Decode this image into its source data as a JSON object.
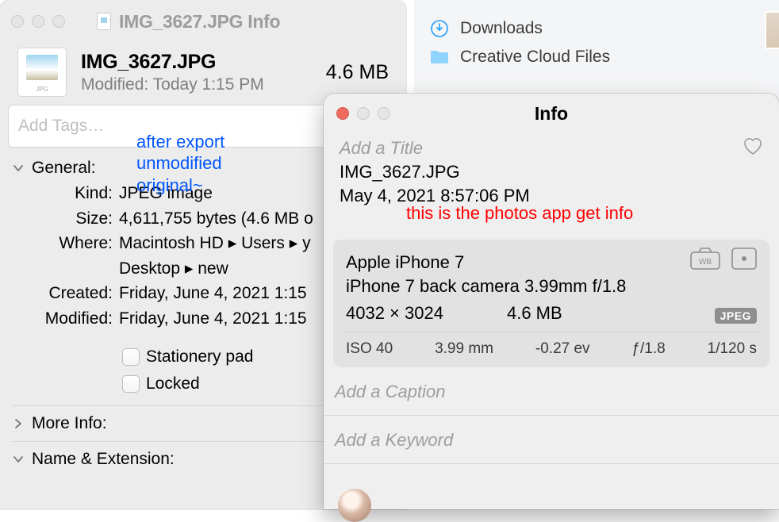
{
  "finder_sidebar": {
    "items": [
      "Downloads",
      "Creative Cloud Files"
    ]
  },
  "getinfo": {
    "window_title": "IMG_3627.JPG Info",
    "filename": "IMG_3627.JPG",
    "size_short": "4.6 MB",
    "modified_short": "Modified:  Today 1:15 PM",
    "tags_placeholder": "Add Tags…",
    "annotation": "after export\nunmodified\noriginal~",
    "sections": {
      "general": "General:",
      "more_info": "More Info:",
      "name_ext": "Name & Extension:"
    },
    "kv": {
      "kind_k": "Kind:",
      "kind_v": "JPEG image",
      "size_k": "Size:",
      "size_v": "4,611,755 bytes (4.6 MB o",
      "where_k": "Where:",
      "where_v1": "Macintosh HD ▸ Users ▸ y",
      "where_v2": "Desktop ▸ new",
      "created_k": "Created:",
      "created_v": "Friday, June 4, 2021 1:15",
      "modified_k": "Modified:",
      "modified_v": "Friday, June 4, 2021 1:15"
    },
    "checks": {
      "stationery": "Stationery pad",
      "locked": "Locked"
    }
  },
  "photos": {
    "window_title": "Info",
    "add_title": "Add a Title",
    "filename": "IMG_3627.JPG",
    "date": "May 4, 2021   8:57:06 PM",
    "annotation": "this is the photos app get info",
    "device": "Apple iPhone 7",
    "lens": "iPhone 7 back camera 3.99mm f/1.8",
    "dimensions": "4032 × 3024",
    "filesize": "4.6 MB",
    "format_badge": "JPEG",
    "exif": {
      "iso": "ISO 40",
      "focal": "3.99 mm",
      "ev": "-0.27 ev",
      "aperture": "ƒ/1.8",
      "shutter": "1/120 s"
    },
    "add_caption": "Add a Caption",
    "add_keyword": "Add a Keyword"
  }
}
